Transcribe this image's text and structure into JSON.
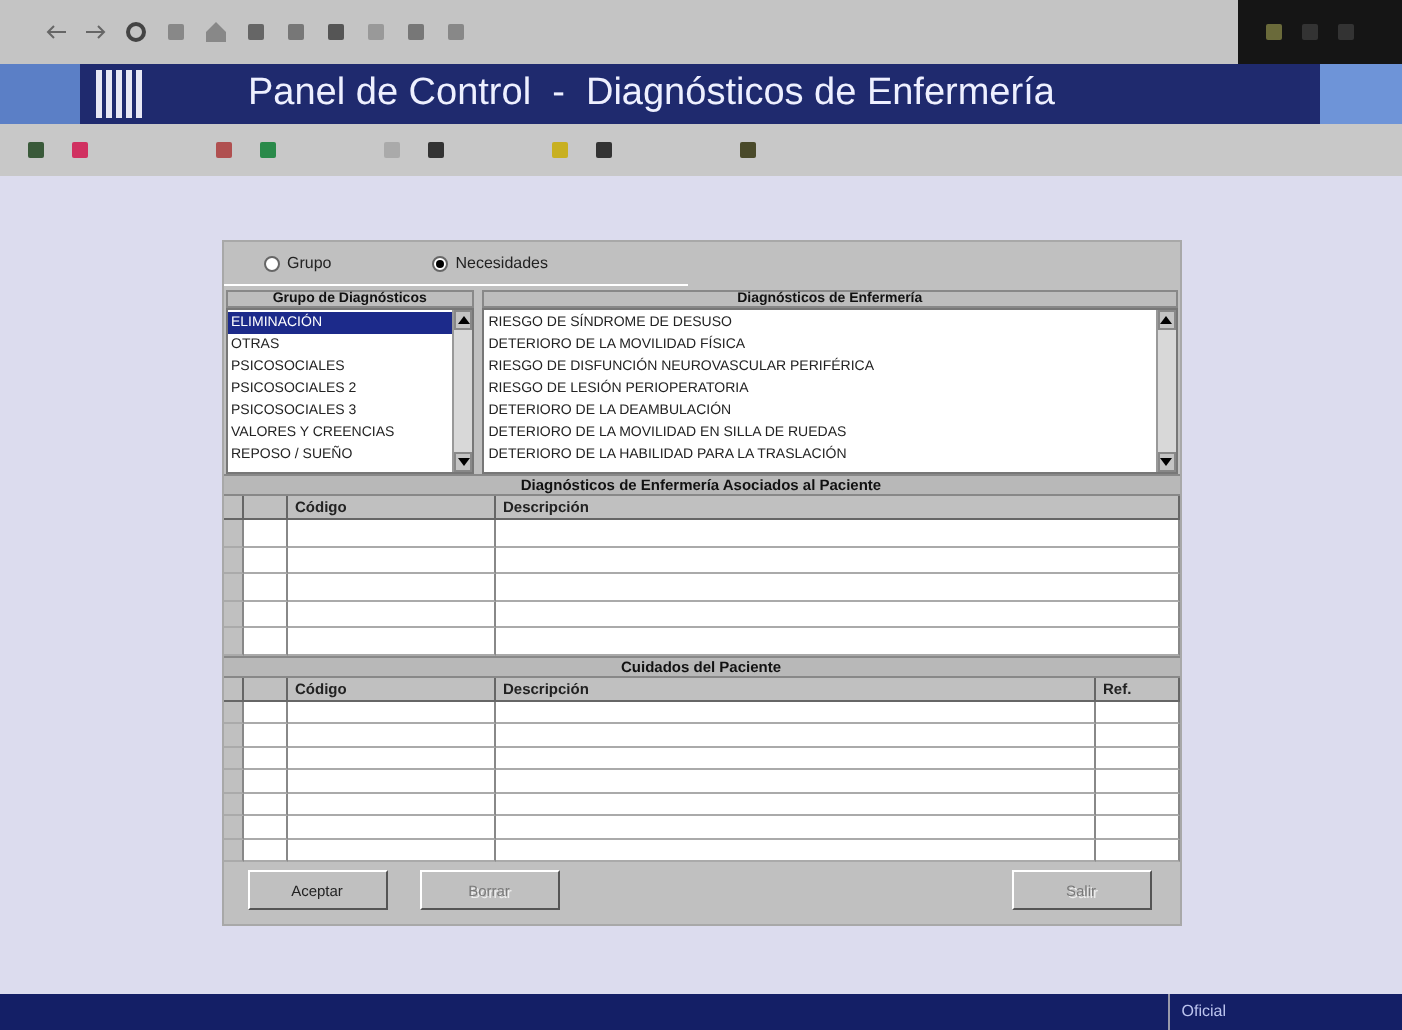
{
  "window": {
    "title": "Panel de Control  -  Diagnósticos de Enfermería"
  },
  "filter": [
    {
      "label": "Grupo",
      "selected": false
    },
    {
      "label": "Necesidades",
      "selected": true
    }
  ],
  "groups": {
    "header": "Grupo de Diagnósticos",
    "items": [
      {
        "label": "ELIMINACIÓN",
        "selected": true
      },
      {
        "label": "OTRAS",
        "selected": false
      },
      {
        "label": "PSICOSOCIALES",
        "selected": false
      },
      {
        "label": "PSICOSOCIALES 2",
        "selected": false
      },
      {
        "label": "PSICOSOCIALES 3",
        "selected": false
      },
      {
        "label": "VALORES Y CREENCIAS",
        "selected": false
      },
      {
        "label": "REPOSO / SUEÑO",
        "selected": false
      }
    ]
  },
  "diagnoses": {
    "header": "Diagnósticos de Enfermería",
    "items": [
      "RIESGO DE SÍNDROME DE DESUSO",
      "DETERIORO DE LA MOVILIDAD FÍSICA",
      "RIESGO DE DISFUNCIÓN NEUROVASCULAR PERIFÉRICA",
      "RIESGO DE LESIÓN PERIOPERATORIA",
      "DETERIORO DE LA DEAMBULACIÓN",
      "DETERIORO DE LA MOVILIDAD EN SILLA DE RUEDAS",
      "DETERIORO DE LA HABILIDAD PARA LA TRASLACIÓN"
    ]
  },
  "associated": {
    "title": "Diagnósticos de Enfermería Asociados al Paciente",
    "columns": [
      "Código",
      "Descripción"
    ]
  },
  "care": {
    "title": "Cuidados del Paciente",
    "columns": [
      "Código",
      "Descripción",
      "Ref."
    ]
  },
  "buttons": [
    {
      "label": "Aceptar",
      "disabled": false
    },
    {
      "label": "Borrar",
      "disabled": true
    },
    {
      "label": "Salir",
      "disabled": true
    }
  ],
  "status_bar": {
    "text": "Oficial"
  }
}
